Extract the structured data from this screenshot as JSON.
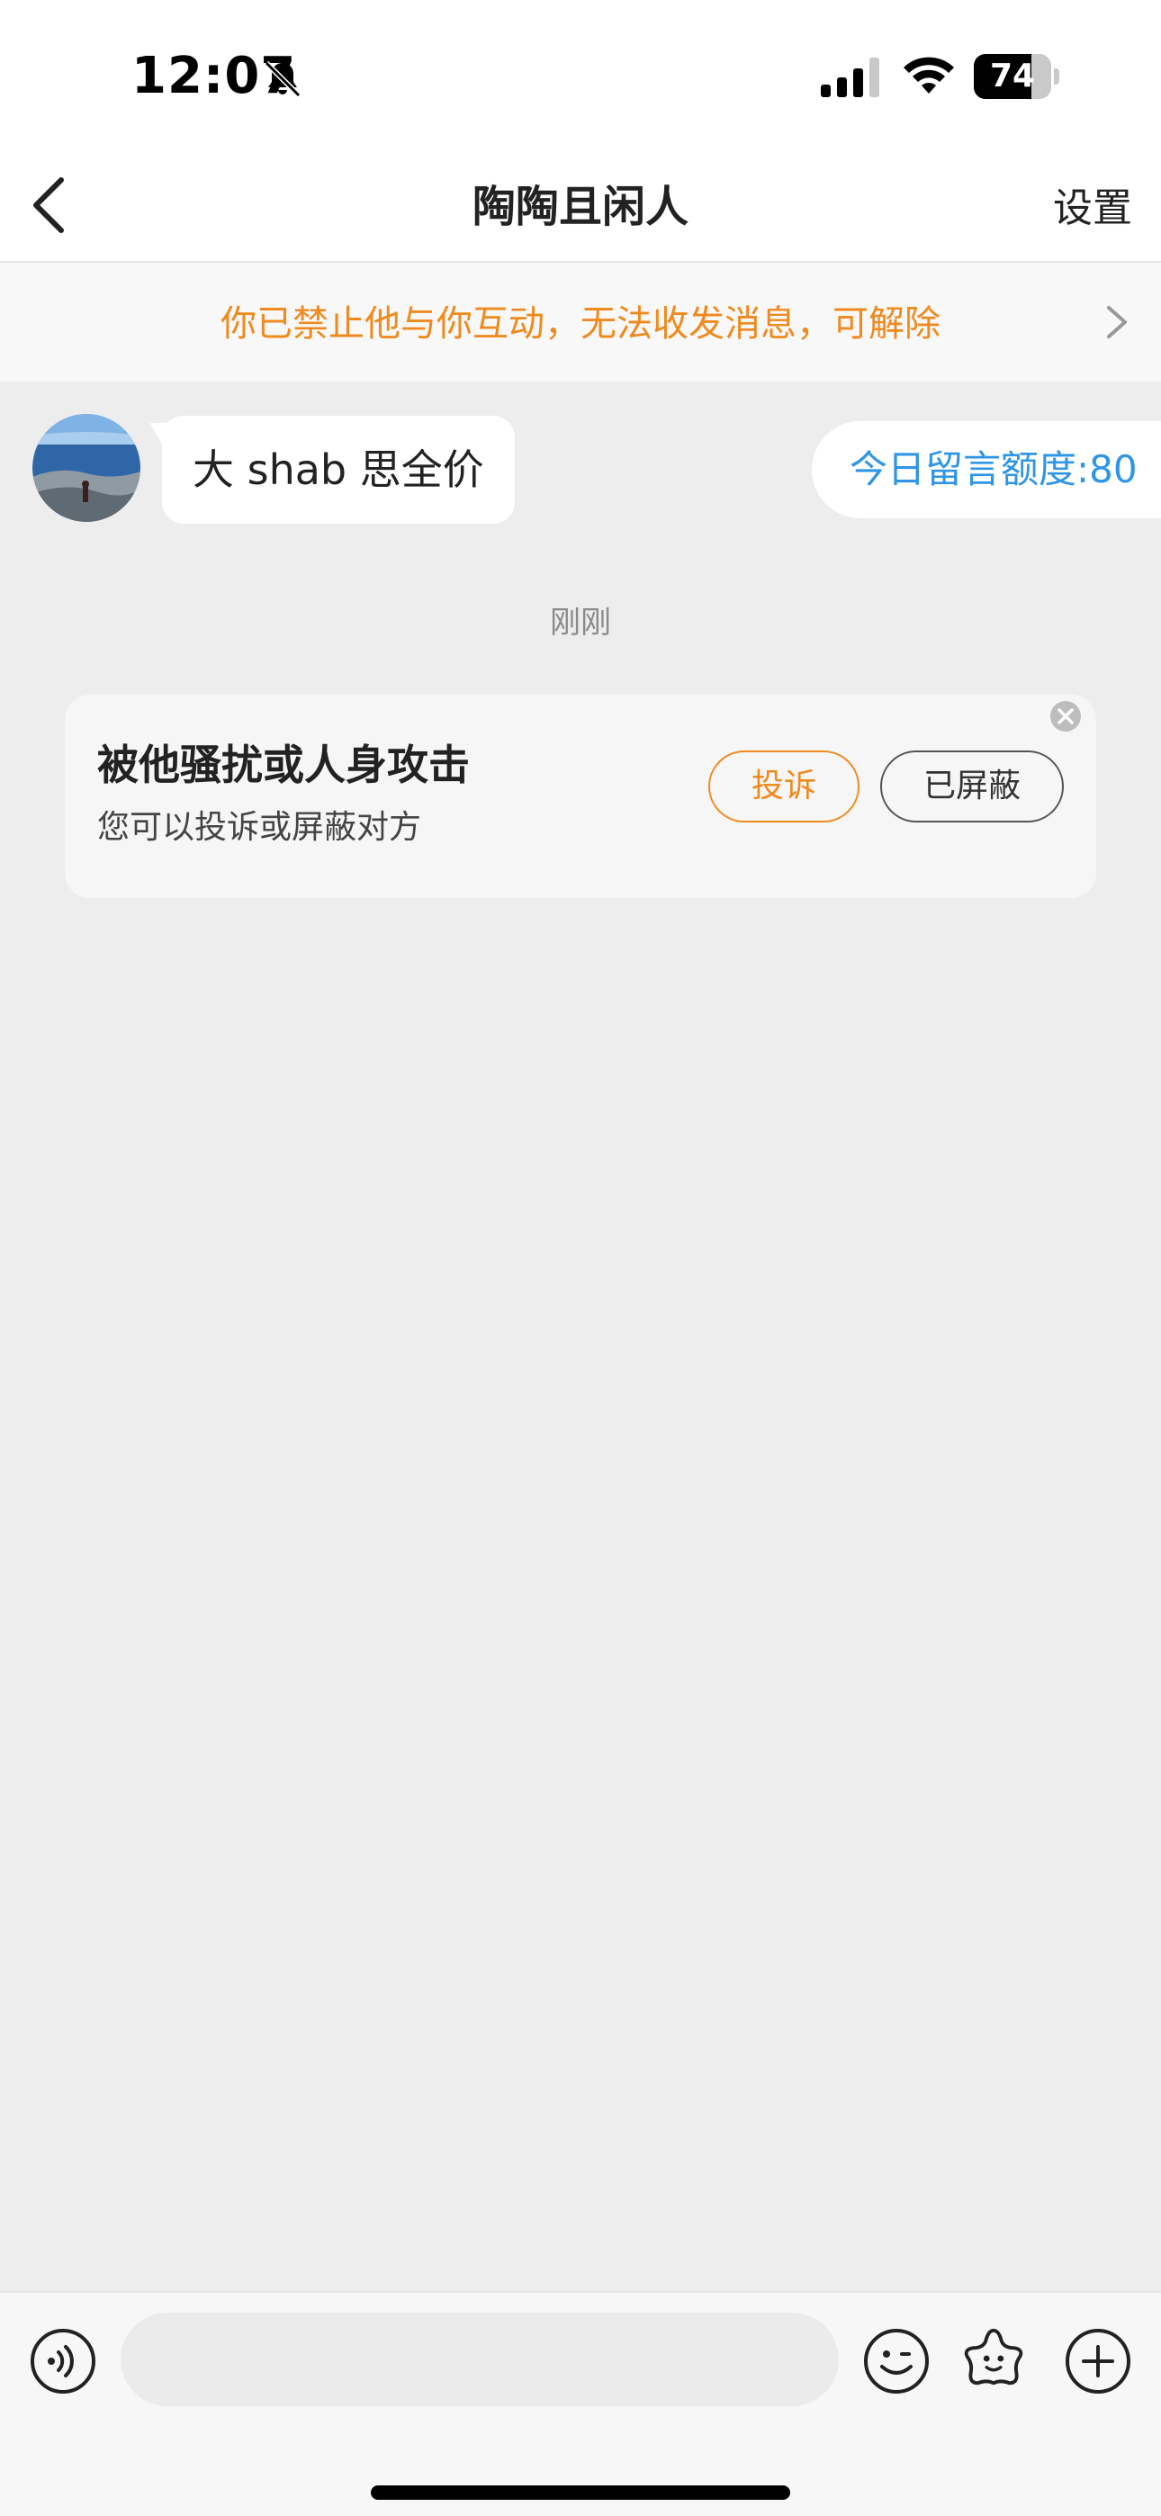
{
  "status_bar": {
    "time": "12:07",
    "battery_level": "74",
    "battery_fraction": 0.74,
    "icons": [
      "bell-slash-icon",
      "signal-icon",
      "wifi-icon",
      "battery-icon"
    ]
  },
  "nav": {
    "title": "陶陶且闲人",
    "settings_label": "设置",
    "back_icon": "chevron-left-icon"
  },
  "banner": {
    "text": "你已禁止他与你互动，无法收发消息，可解除",
    "color": "#f08a1e"
  },
  "chat": {
    "message": {
      "text": "大 shab 思全价"
    },
    "quota_label": "今日留言额度:80",
    "timestamp": "刚刚",
    "card": {
      "title": "被他骚扰或人身攻击",
      "subtitle": "您可以投诉或屏蔽对方",
      "report_label": "投诉",
      "blocked_label": "已屏蔽"
    }
  },
  "input_bar": {
    "placeholder": "",
    "icons": [
      "voice-icon",
      "emoji-icon",
      "sticker-icon",
      "plus-icon"
    ]
  },
  "colors": {
    "accent_orange": "#f08a1e",
    "accent_blue": "#2f95e6",
    "chat_bg": "#ededed"
  }
}
